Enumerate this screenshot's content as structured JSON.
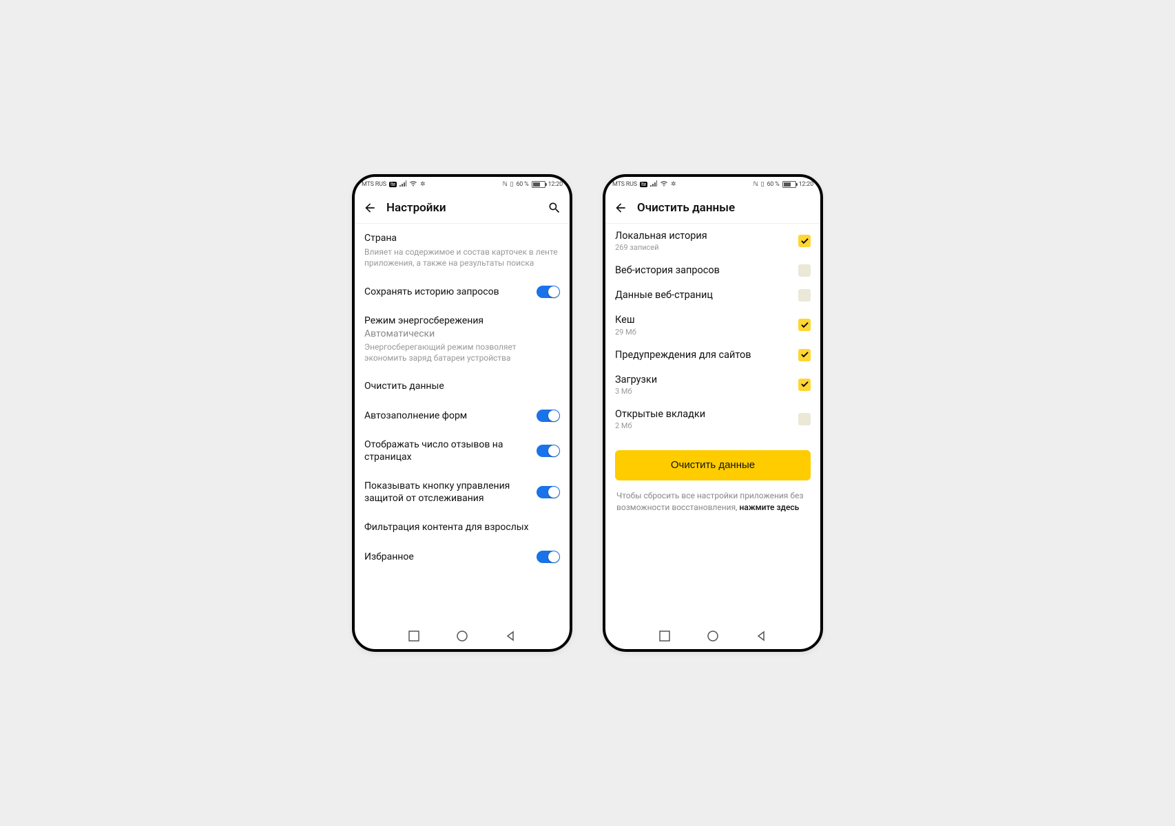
{
  "status": {
    "carrier": "MTS RUS",
    "badge": "lte",
    "battery_text": "60 %",
    "time": "12:20"
  },
  "phone1": {
    "title": "Настройки",
    "items": {
      "country": {
        "label": "Страна",
        "desc": "Влияет на содержимое и состав карточек в ленте приложения, а также на результаты поиска"
      },
      "save_history": {
        "label": "Сохранять историю запросов"
      },
      "power": {
        "label": "Режим энергосбережения",
        "value": "Автоматически",
        "desc": "Энергосберегающий режим позволяет экономить заряд батареи устройства"
      },
      "clear_data": {
        "label": "Очистить данные"
      },
      "autofill": {
        "label": "Автозаполнение форм"
      },
      "reviews": {
        "label": "Отображать число отзывов на страницах"
      },
      "tracking": {
        "label": "Показывать кнопку управления защитой от отслеживания"
      },
      "adult": {
        "label": "Фильтрация контента для взрослых"
      },
      "favorites": {
        "label": "Избранное"
      }
    }
  },
  "phone2": {
    "title": "Очистить данные",
    "rows": {
      "local_history": {
        "label": "Локальная история",
        "sub": "269 записей"
      },
      "web_history": {
        "label": "Веб-история запросов"
      },
      "web_data": {
        "label": "Данные веб-страниц"
      },
      "cache": {
        "label": "Кеш",
        "sub": "29 Мб"
      },
      "warnings": {
        "label": "Предупреждения для сайтов"
      },
      "downloads": {
        "label": "Загрузки",
        "sub": "3 Мб"
      },
      "open_tabs": {
        "label": "Открытые вкладки",
        "sub": "2 Мб"
      }
    },
    "button": "Очистить данные",
    "footnote_prefix": "Чтобы сбросить все настройки приложения без возможности восстановления, ",
    "footnote_strong": "нажмите здесь"
  }
}
